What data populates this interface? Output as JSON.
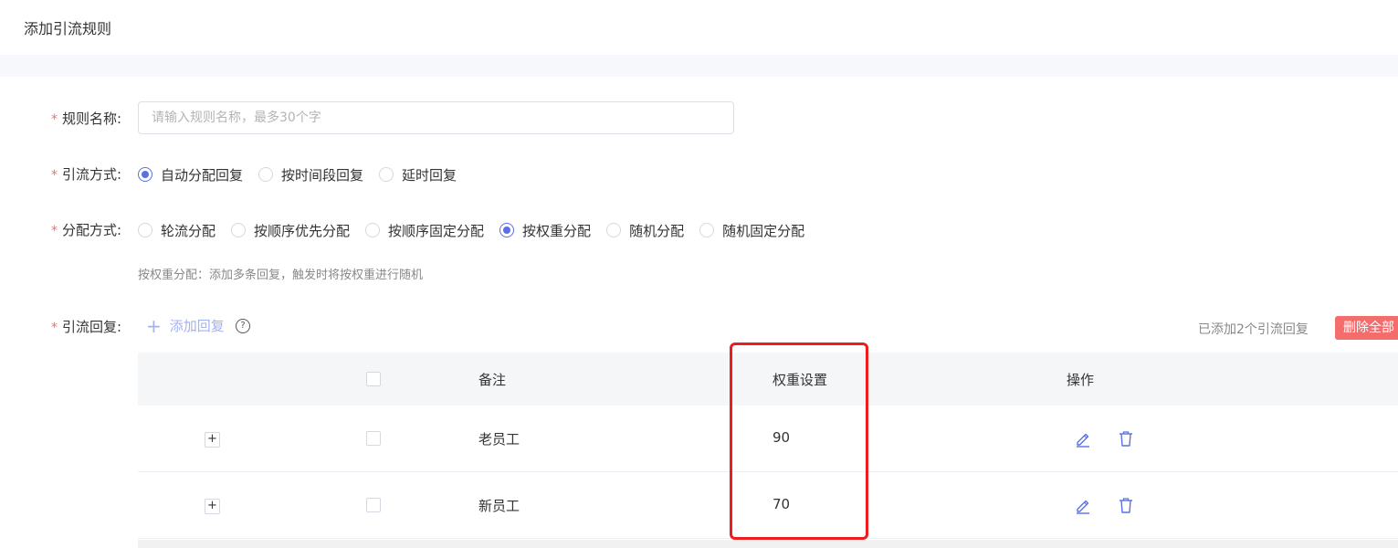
{
  "header": {
    "title": "添加引流规则"
  },
  "form": {
    "rule_name": {
      "label": "规则名称:",
      "value": "",
      "placeholder": "请输入规则名称，最多30个字"
    },
    "traffic_method": {
      "label": "引流方式:",
      "options": [
        "自动分配回复",
        "按时间段回复",
        "延时回复"
      ],
      "selected": "自动分配回复"
    },
    "distribution": {
      "label": "分配方式:",
      "options": [
        "轮流分配",
        "按顺序优先分配",
        "按顺序固定分配",
        "按权重分配",
        "随机分配",
        "随机固定分配"
      ],
      "selected": "按权重分配",
      "hint": "按权重分配：添加多条回复，触发时将按权重进行随机"
    },
    "replies": {
      "label": "引流回复:",
      "add_label": "添加回复",
      "added_count_text": "已添加2个引流回复",
      "delete_all_label": "删除全部"
    }
  },
  "table": {
    "headers": {
      "remark": "备注",
      "weight": "权重设置",
      "actions": "操作"
    },
    "rows": [
      {
        "remark": "老员工",
        "weight": "90",
        "expand": "+"
      },
      {
        "remark": "新员工",
        "weight": "70",
        "expand": "+"
      }
    ]
  },
  "colors": {
    "accent": "#5b6fe6",
    "danger": "#f56c6c",
    "highlight": "#ee1c1c",
    "required": "#f56c6c"
  },
  "icons": {
    "edit": "edit-icon",
    "delete": "trash-icon",
    "help": "question-circle-icon",
    "add": "plus-icon"
  }
}
